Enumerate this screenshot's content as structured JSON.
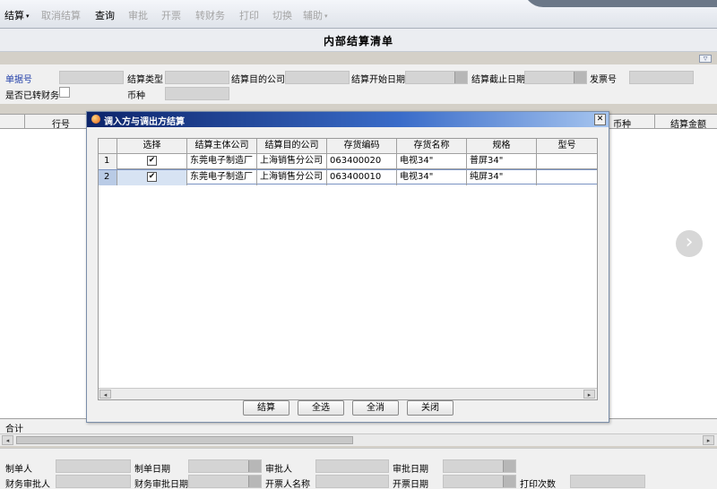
{
  "toolbar": {
    "items": [
      {
        "label": "结算",
        "enabled": true,
        "has_menu": true
      },
      {
        "label": "取消结算",
        "enabled": false
      },
      {
        "label": "查询",
        "enabled": true
      },
      {
        "label": "审批",
        "enabled": false
      },
      {
        "label": "开票",
        "enabled": false
      },
      {
        "label": "转财务",
        "enabled": false
      },
      {
        "label": "打印",
        "enabled": false
      },
      {
        "label": "切换",
        "enabled": false
      },
      {
        "label": "辅助",
        "enabled": false,
        "has_menu": true
      }
    ],
    "menu_arrow": "▾"
  },
  "page": {
    "title": "内部结算清单",
    "collapse_glyph": "▽"
  },
  "filter": {
    "bill_no_label": "单据号",
    "settle_type_label": "结算类型",
    "target_company_label": "结算目的公司",
    "start_date_label": "结算开始日期",
    "end_date_label": "结算截止日期",
    "invoice_no_label": "发票号",
    "transferred_label": "是否已转财务",
    "currency_label": "币种"
  },
  "main_grid": {
    "row_no_header": "行号",
    "currency_header": "币种",
    "amount_header": "结算金额",
    "total_label": "合计",
    "next_glyph": "›"
  },
  "footer": {
    "maker_label": "制单人",
    "make_date_label": "制单日期",
    "approver_label": "审批人",
    "approve_date_label": "审批日期",
    "fin_approver_label": "财务审批人",
    "fin_approve_date_label": "财务审批日期",
    "invoicer_label": "开票人名称",
    "invoice_date_label": "开票日期",
    "print_count_label": "打印次数"
  },
  "dialog": {
    "title": "调入方与调出方结算",
    "close_glyph": "✕",
    "columns": [
      "选择",
      "结算主体公司",
      "结算目的公司",
      "存货编码",
      "存货名称",
      "规格",
      "型号"
    ],
    "rows": [
      {
        "no": "1",
        "checked": "✔",
        "main_company": "东莞电子制造厂",
        "target_company": "上海销售分公司",
        "code": "063400020",
        "name": "电视34\"",
        "spec": "普屏34\"",
        "model": ""
      },
      {
        "no": "2",
        "checked": "✔",
        "main_company": "东莞电子制造厂",
        "target_company": "上海销售分公司",
        "code": "063400010",
        "name": "电视34\"",
        "spec": "纯屏34\"",
        "model": ""
      }
    ],
    "buttons": {
      "settle": "结算",
      "select_all": "全选",
      "cancel_all": "全消",
      "close": "关闭"
    },
    "scroll_left": "◂",
    "scroll_right": "▸"
  },
  "colors": {
    "title_bar": "#0c246a",
    "selected_row": "#b9cbe6",
    "label_blue": "#1f3da8"
  }
}
